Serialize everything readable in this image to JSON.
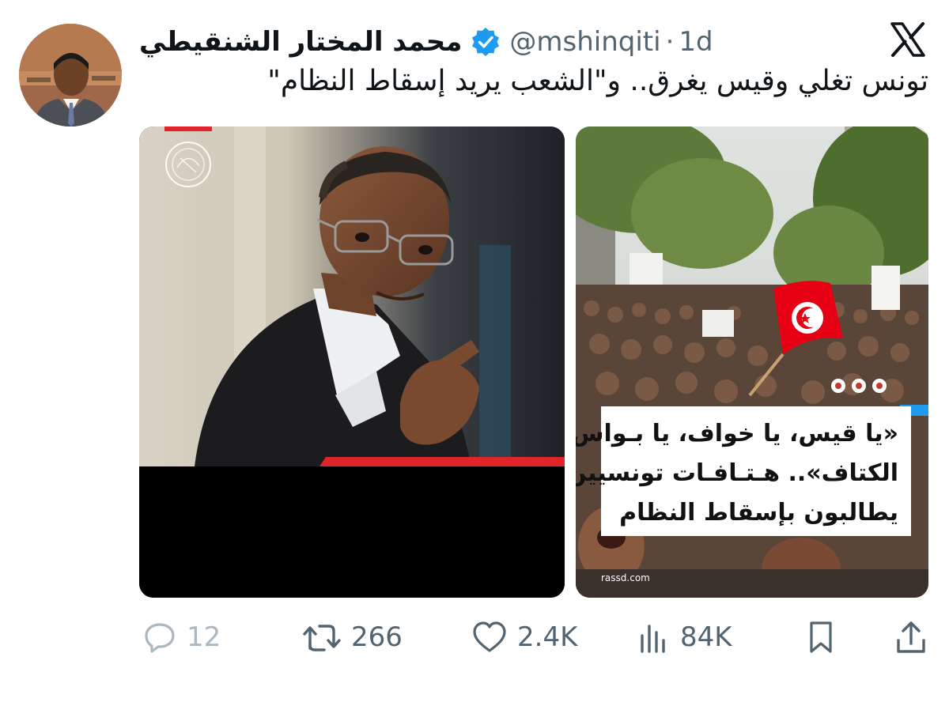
{
  "author": {
    "name": "محمد المختار الشنقيطي",
    "handle": "@mshinqiti",
    "separator": "·",
    "time": "1d"
  },
  "tweet": {
    "text": "تونس تغلي وقيس يغرق.. و\"الشعب يريد إسقاط النظام\""
  },
  "media": {
    "right_caption": [
      "«يا قيس، يا خواف، يا بـواس",
      "الكتاف».. هـتـافـات تونسيين",
      "يطالبون بإسقاط النظام"
    ],
    "right_source": "rassd.com"
  },
  "actions": {
    "replies": "12",
    "reposts": "266",
    "likes": "2.4K",
    "views": "84K"
  },
  "colors": {
    "verified": "#1d9bf0",
    "muted": "#536471",
    "tunisia_red": "#e70013",
    "accent_red": "#e0242a"
  },
  "icons": [
    "x-logo-icon",
    "verified-badge-icon",
    "reply-icon",
    "repost-icon",
    "like-icon",
    "views-icon",
    "bookmark-icon",
    "share-icon"
  ]
}
